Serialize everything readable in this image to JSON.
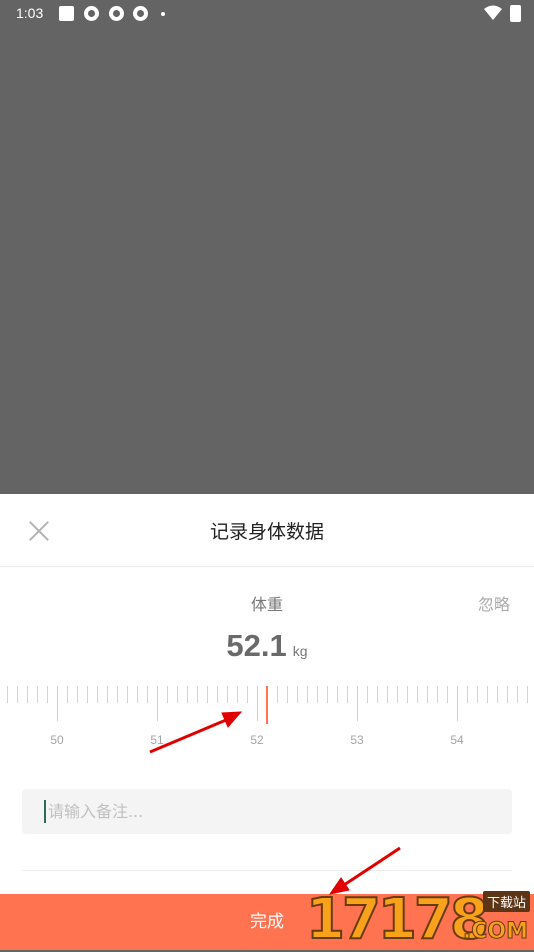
{
  "status_bar": {
    "time": "1:03",
    "icons": [
      "square-app-icon",
      "aperture-icon",
      "aperture-icon",
      "aperture-icon",
      "dot-icon",
      "wifi-icon",
      "battery-icon"
    ]
  },
  "sheet": {
    "title": "记录身体数据",
    "close_icon": "close-icon",
    "metric_label": "体重",
    "ignore_label": "忽略",
    "value": "52.1",
    "unit": "kg",
    "ruler": {
      "labels": [
        "50",
        "51",
        "52",
        "53",
        "54"
      ],
      "selected_value": 52.1
    },
    "note_placeholder": "请输入备注...",
    "done_label": "完成"
  },
  "colors": {
    "accent": "#ff7351",
    "overlay": "#646464",
    "annotation_arrow": "#e00000"
  },
  "watermark": {
    "digits": "17178",
    "badge": "下载站",
    "domain": ".COM"
  }
}
